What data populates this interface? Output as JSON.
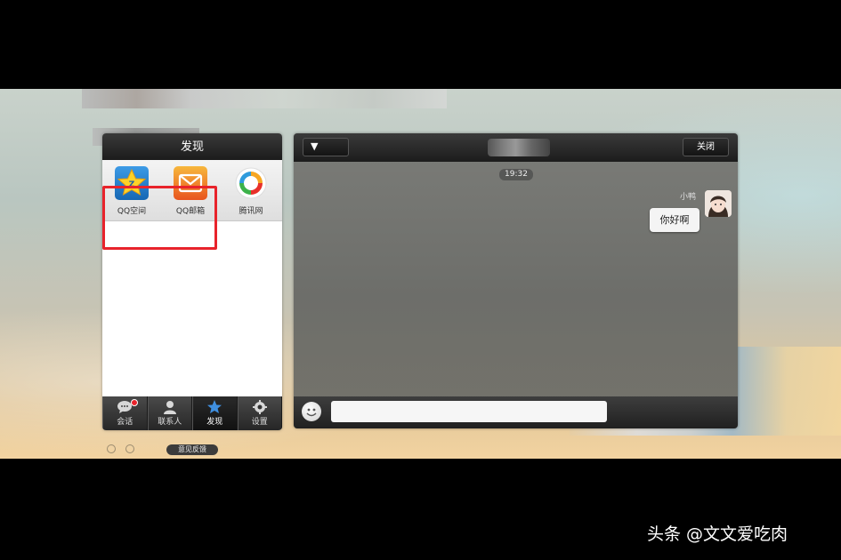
{
  "left_panel": {
    "title": "发现",
    "apps": [
      {
        "label": "QQ空间",
        "icon": "qzone-icon"
      },
      {
        "label": "QQ邮箱",
        "icon": "mail-icon"
      },
      {
        "label": "腾讯网",
        "icon": "tencent-news-icon"
      }
    ],
    "tabs": [
      {
        "label": "会话",
        "icon": "chat-icon"
      },
      {
        "label": "联系人",
        "icon": "contacts-icon"
      },
      {
        "label": "发现",
        "icon": "discover-star-icon",
        "active": true
      },
      {
        "label": "设置",
        "icon": "gear-icon"
      }
    ],
    "feedback_label": "意见反馈"
  },
  "chat": {
    "dropdown_label": "▼",
    "close_label": "关闭",
    "timestamp": "19:32",
    "sender_name": "小鸭",
    "message": "你好啊",
    "input_placeholder": ""
  },
  "watermark": "头条 @文文爱吃肉",
  "colors": {
    "highlight": "#e8232b",
    "header_dark": "#1c1c1c",
    "qzone_blue": "#1e7fd0",
    "mail_orange": "#f29a1c"
  }
}
